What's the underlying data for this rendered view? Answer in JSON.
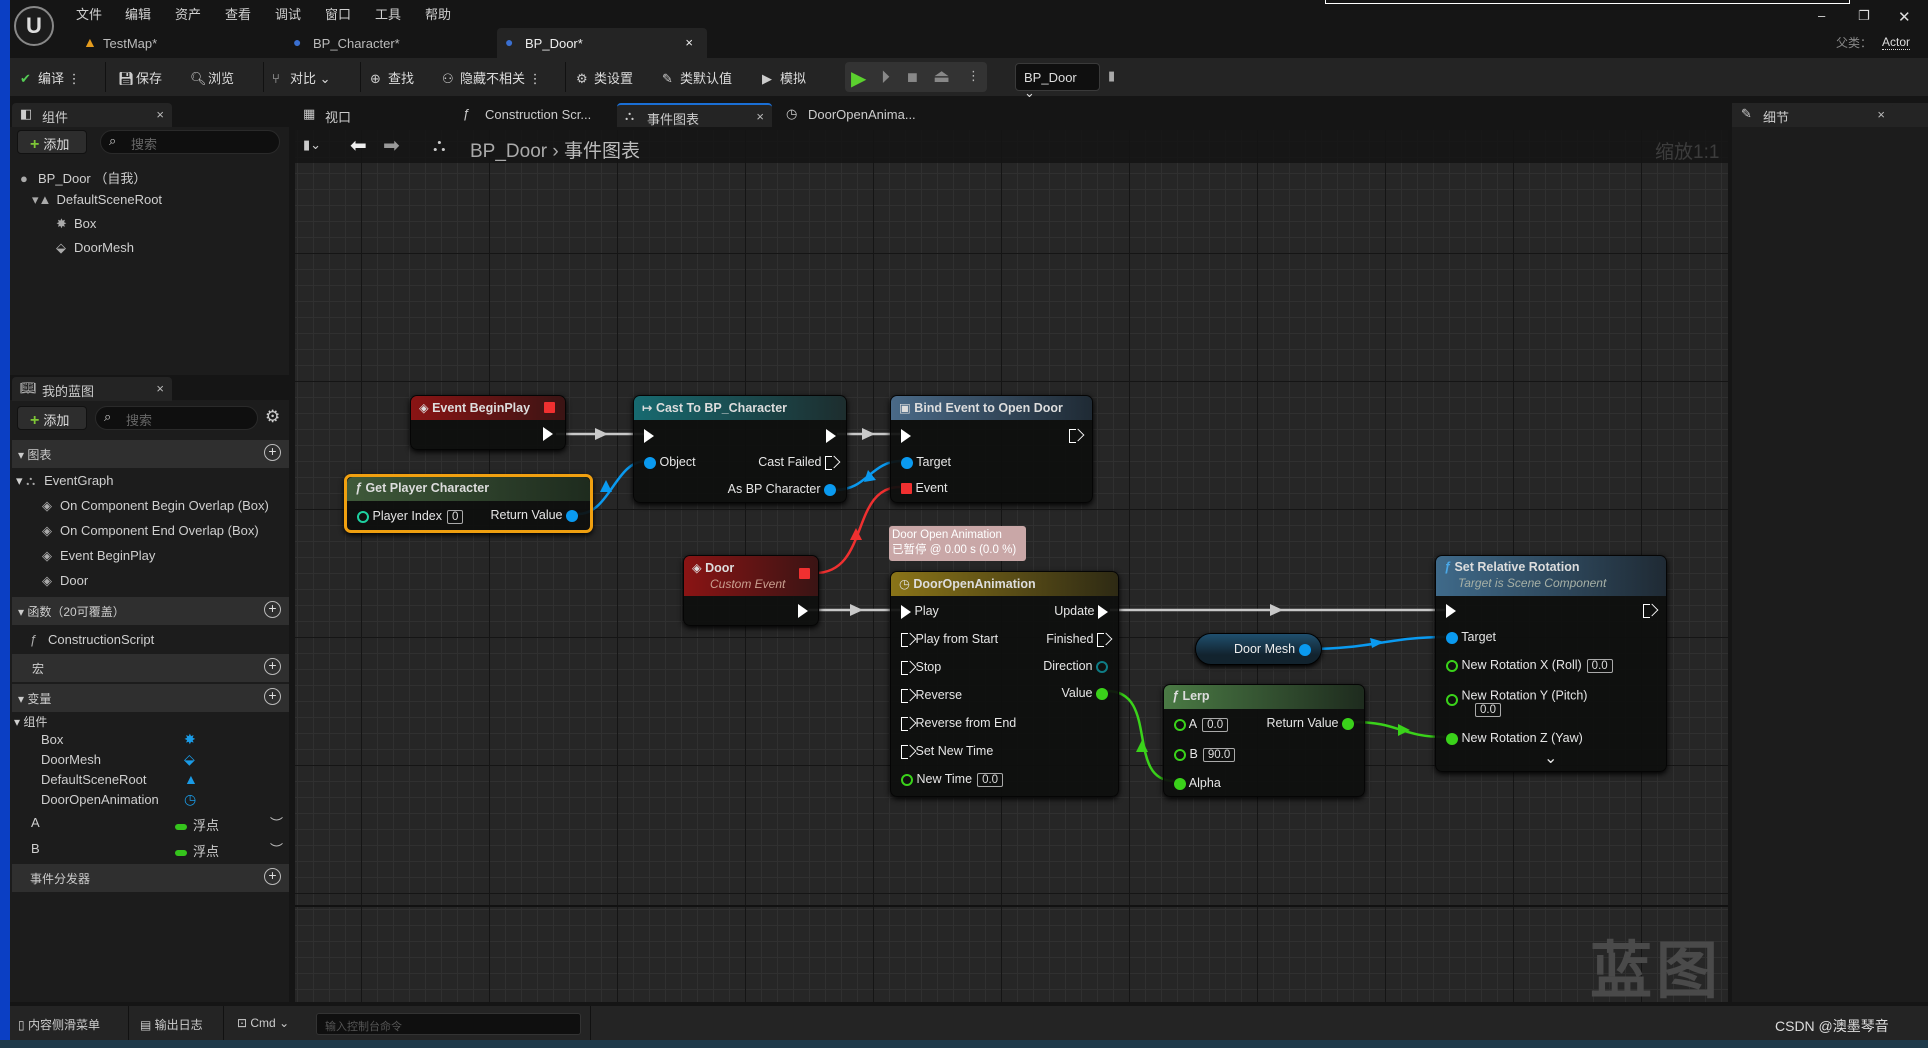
{
  "menu": [
    "文件",
    "编辑",
    "资产",
    "查看",
    "调试",
    "窗口",
    "工具",
    "帮助"
  ],
  "doc_tabs": [
    {
      "label": "TestMap*"
    },
    {
      "label": "BP_Character*"
    },
    {
      "label": "BP_Door*",
      "close": "×"
    }
  ],
  "window": {
    "parent_label": "父类：",
    "parent_value": "Actor",
    "minimize": "–",
    "restore": "❐",
    "close": "✕"
  },
  "toolbar": {
    "compile": "编译",
    "save": "保存",
    "browse": "浏览",
    "diff": "对比",
    "find": "查找",
    "hide_unrelated": "隐藏不相关",
    "class_settings": "类设置",
    "class_defaults": "类默认值",
    "simulate": "模拟",
    "debug_object": "BP_Door"
  },
  "components_panel": {
    "title": "组件",
    "add": "添加",
    "search_placeholder": "搜索",
    "tree": [
      {
        "label": "BP_Door （自我）"
      },
      {
        "label": "DefaultSceneRoot"
      },
      {
        "label": "Box"
      },
      {
        "label": "DoorMesh"
      }
    ]
  },
  "my_blueprint": {
    "title": "我的蓝图",
    "add": "添加",
    "search_placeholder": "搜索",
    "graphs_label": "图表",
    "event_graph": "EventGraph",
    "events": [
      "On Component Begin Overlap (Box)",
      "On Component End Overlap (Box)",
      "Event BeginPlay",
      "Door"
    ],
    "functions_label": "函数（20可覆盖）",
    "construction_script": "ConstructionScript",
    "macros_label": "宏",
    "variables_label": "变量",
    "components_label": "组件",
    "component_vars": [
      "Box",
      "DoorMesh",
      "DefaultSceneRoot",
      "DoorOpenAnimation"
    ],
    "vars": [
      {
        "name": "A",
        "type": "浮点"
      },
      {
        "name": "B",
        "type": "浮点"
      }
    ],
    "dispatchers_label": "事件分发器"
  },
  "editor_tabs": [
    {
      "label": "视口"
    },
    {
      "label": "Construction Scr..."
    },
    {
      "label": "事件图表"
    },
    {
      "label": "DoorOpenAnima..."
    }
  ],
  "graph": {
    "breadcrumb_root": "BP_Door",
    "breadcrumb_sep": "›",
    "breadcrumb_current": "事件图表",
    "zoom": "缩放1:1",
    "watermark": "蓝图",
    "nodes": {
      "begin_play": {
        "title": "Event BeginPlay",
        "color": "#8a1a1a"
      },
      "get_player": {
        "title": "Get Player Character",
        "player_index_label": "Player Index",
        "player_index": "0",
        "return": "Return Value"
      },
      "cast": {
        "title": "Cast To BP_Character",
        "object": "Object",
        "cast_failed": "Cast Failed",
        "as": "As BP Character"
      },
      "bind": {
        "title": "Bind Event to Open Door",
        "target": "Target",
        "event": "Event"
      },
      "door": {
        "title": "Door",
        "subtitle": "Custom Event"
      },
      "comment": {
        "line1": "Door Open Animation",
        "line2": "已暂停 @ 0.00 s (0.0 %)"
      },
      "timeline": {
        "title": "DoorOpenAnimation",
        "inputs": [
          "Play",
          "Play from Start",
          "Stop",
          "Reverse",
          "Reverse from End",
          "Set New Time"
        ],
        "new_time_label": "New Time",
        "new_time": "0.0",
        "outputs": [
          "Update",
          "Finished",
          "Direction",
          "Value"
        ]
      },
      "door_mesh": {
        "title": "Door Mesh"
      },
      "lerp": {
        "title": "Lerp",
        "a_label": "A",
        "a": "0.0",
        "b_label": "B",
        "b": "90.0",
        "alpha": "Alpha",
        "return": "Return Value"
      },
      "set_rot": {
        "title": "Set Relative Rotation",
        "subtitle": "Target is Scene Component",
        "target": "Target",
        "x_label": "New Rotation X (Roll)",
        "x": "0.0",
        "y_label": "New Rotation Y (Pitch)",
        "y": "0.0",
        "z_label": "New Rotation Z (Yaw)",
        "expand": "⌄"
      }
    }
  },
  "details": {
    "title": "细节"
  },
  "bottom": {
    "content_drawer": "内容侧滑菜单",
    "output_log": "输出日志",
    "cmd": "Cmd",
    "console_placeholder": "输入控制台命令",
    "credit": "CSDN @澳墨琴音"
  }
}
